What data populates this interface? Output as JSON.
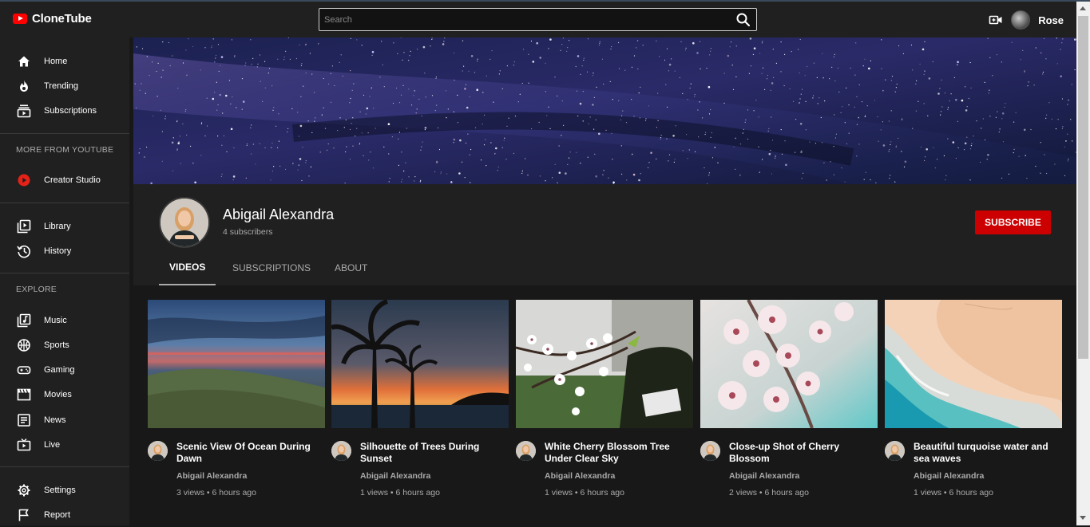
{
  "app": {
    "name": "CloneTube"
  },
  "search": {
    "placeholder": "Search"
  },
  "user": {
    "name": "Rose"
  },
  "sidebar": {
    "primary": [
      {
        "label": "Home",
        "icon": "home-icon"
      },
      {
        "label": "Trending",
        "icon": "flame-icon"
      },
      {
        "label": "Subscriptions",
        "icon": "subscriptions-icon"
      }
    ],
    "more_title": "MORE FROM YOUTUBE",
    "more": [
      {
        "label": "Creator Studio",
        "icon": "creator-studio-icon"
      }
    ],
    "library": [
      {
        "label": "Library",
        "icon": "library-icon"
      },
      {
        "label": "History",
        "icon": "history-icon"
      }
    ],
    "explore_title": "EXPLORE",
    "explore": [
      {
        "label": "Music",
        "icon": "music-icon"
      },
      {
        "label": "Sports",
        "icon": "sports-icon"
      },
      {
        "label": "Gaming",
        "icon": "gaming-icon"
      },
      {
        "label": "Movies",
        "icon": "movies-icon"
      },
      {
        "label": "News",
        "icon": "news-icon"
      },
      {
        "label": "Live",
        "icon": "live-icon"
      }
    ],
    "footer": [
      {
        "label": "Settings",
        "icon": "settings-icon"
      },
      {
        "label": "Report",
        "icon": "flag-icon"
      }
    ]
  },
  "channel": {
    "name": "Abigail Alexandra",
    "subscribers": "4 subscribers",
    "subscribe_label": "SUBSCRIBE",
    "tabs": [
      {
        "label": "VIDEOS",
        "active": true
      },
      {
        "label": "SUBSCRIPTIONS",
        "active": false
      },
      {
        "label": "ABOUT",
        "active": false
      }
    ]
  },
  "videos": [
    {
      "title": "Scenic View Of Ocean During Dawn",
      "channel": "Abigail Alexandra",
      "meta": "3 views • 6 hours ago"
    },
    {
      "title": "Silhouette of Trees During Sunset",
      "channel": "Abigail Alexandra",
      "meta": "1 views • 6 hours ago"
    },
    {
      "title": "White Cherry Blossom Tree Under Clear Sky",
      "channel": "Abigail Alexandra",
      "meta": "1 views • 6 hours ago"
    },
    {
      "title": "Close-up Shot of Cherry Blossom",
      "channel": "Abigail Alexandra",
      "meta": "2 views • 6 hours ago"
    },
    {
      "title": "Beautiful turquoise water and sea waves",
      "channel": "Abigail Alexandra",
      "meta": "1 views • 6 hours ago"
    }
  ],
  "colors": {
    "accent": "#cc0000",
    "background": "#181818",
    "surface": "#202020"
  }
}
